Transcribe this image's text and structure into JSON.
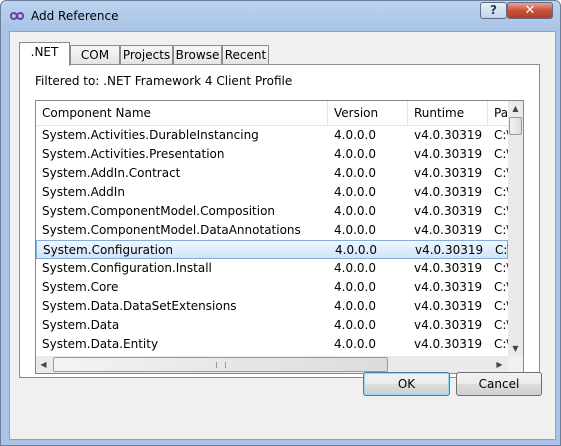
{
  "window": {
    "title": "Add Reference",
    "help_label": "?",
    "close_label": "✕"
  },
  "tabs": [
    ".NET",
    "COM",
    "Projects",
    "Browse",
    "Recent"
  ],
  "filter_text": "Filtered to: .NET Framework 4 Client Profile",
  "columns": [
    "Component Name",
    "Version",
    "Runtime",
    "Pa"
  ],
  "rows": [
    {
      "name": "System.Activities.DurableInstancing",
      "version": "4.0.0.0",
      "runtime": "v4.0.30319",
      "path": "C:\\"
    },
    {
      "name": "System.Activities.Presentation",
      "version": "4.0.0.0",
      "runtime": "v4.0.30319",
      "path": "C:\\"
    },
    {
      "name": "System.AddIn.Contract",
      "version": "4.0.0.0",
      "runtime": "v4.0.30319",
      "path": "C:\\"
    },
    {
      "name": "System.AddIn",
      "version": "4.0.0.0",
      "runtime": "v4.0.30319",
      "path": "C:\\"
    },
    {
      "name": "System.ComponentModel.Composition",
      "version": "4.0.0.0",
      "runtime": "v4.0.30319",
      "path": "C:\\"
    },
    {
      "name": "System.ComponentModel.DataAnnotations",
      "version": "4.0.0.0",
      "runtime": "v4.0.30319",
      "path": "C:\\"
    },
    {
      "name": "System.Configuration",
      "version": "4.0.0.0",
      "runtime": "v4.0.30319",
      "path": "C:\\"
    },
    {
      "name": "System.Configuration.Install",
      "version": "4.0.0.0",
      "runtime": "v4.0.30319",
      "path": "C:\\"
    },
    {
      "name": "System.Core",
      "version": "4.0.0.0",
      "runtime": "v4.0.30319",
      "path": "C:\\"
    },
    {
      "name": "System.Data.DataSetExtensions",
      "version": "4.0.0.0",
      "runtime": "v4.0.30319",
      "path": "C:\\"
    },
    {
      "name": "System.Data",
      "version": "4.0.0.0",
      "runtime": "v4.0.30319",
      "path": "C:\\"
    },
    {
      "name": "System.Data.Entity",
      "version": "4.0.0.0",
      "runtime": "v4.0.30319",
      "path": "C:\\"
    }
  ],
  "selected_row": 6,
  "buttons": {
    "ok": "OK",
    "cancel": "Cancel"
  },
  "colors": {
    "selection": "#cfe4fb",
    "selection_border": "#84acdd",
    "close_button": "#c8523a",
    "title_bar": "#a9c4e6"
  }
}
